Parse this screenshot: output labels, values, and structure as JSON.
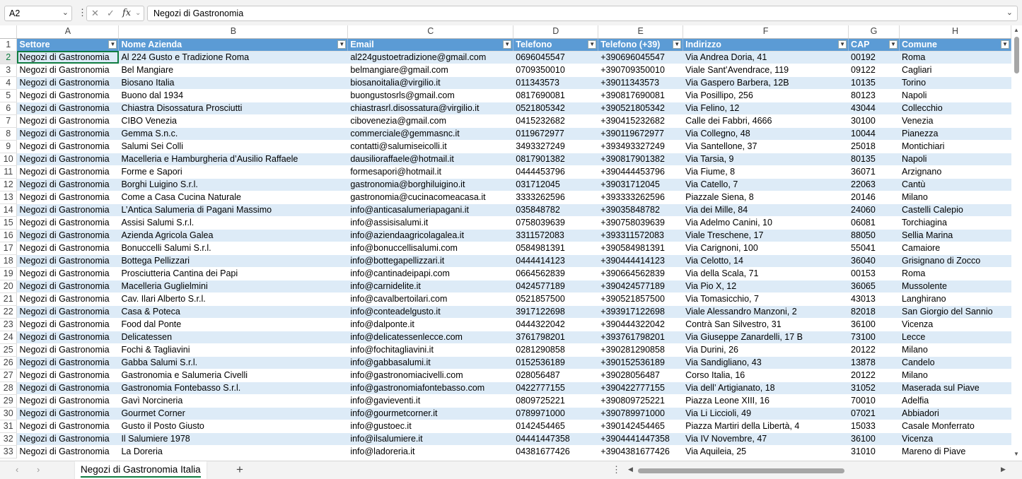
{
  "namebox": {
    "value": "A2"
  },
  "formula": {
    "value": "Negozi di Gastronomia",
    "fx_label": "fx"
  },
  "columns": [
    "A",
    "B",
    "C",
    "D",
    "E",
    "F",
    "G",
    "H"
  ],
  "headers": [
    "Settore",
    "Nome Azienda",
    "Email",
    "Telefono",
    "Telefono (+39)",
    "Indirizzo",
    "CAP",
    "Comune"
  ],
  "rows": [
    [
      "Negozi di Gastronomia",
      "Al 224 Gusto e Tradizione Roma",
      "al224gustoetradizione@gmail.com",
      "0696045547",
      "+390696045547",
      "Via Andrea Doria, 41",
      "00192",
      "Roma"
    ],
    [
      "Negozi di Gastronomia",
      "Bel Mangiare",
      "belmangiare@gmail.com",
      "0709350010",
      "+390709350010",
      "Viale Sant’Avendrace, 119",
      "09122",
      "Cagliari"
    ],
    [
      "Negozi di Gastronomia",
      "Biosano Italia",
      "biosanoitalia@virgilio.it",
      "011343573",
      "+39011343573",
      "Via Gaspero Barbera, 12B",
      "10135",
      "Torino"
    ],
    [
      "Negozi di Gastronomia",
      "Buono dal 1934",
      "buongustosrls@gmail.com",
      "0817690081",
      "+390817690081",
      "Via Posillipo, 256",
      "80123",
      "Napoli"
    ],
    [
      "Negozi di Gastronomia",
      "Chiastra Disossatura Prosciutti",
      "chiastrasrl.disossatura@virgilio.it",
      "0521805342",
      "+390521805342",
      "Via Felino, 12",
      "43044",
      "Collecchio"
    ],
    [
      "Negozi di Gastronomia",
      "CIBO Venezia",
      "cibovenezia@gmail.com",
      "0415232682",
      "+390415232682",
      "Calle dei Fabbri, 4666",
      "30100",
      "Venezia"
    ],
    [
      "Negozi di Gastronomia",
      "Gemma S.n.c.",
      "commerciale@gemmasnc.it",
      "0119672977",
      "+390119672977",
      "Via Collegno, 48",
      "10044",
      "Pianezza"
    ],
    [
      "Negozi di Gastronomia",
      "Salumi Sei Colli",
      "contatti@salumiseicolli.it",
      "3493327249",
      "+393493327249",
      "Via Santellone, 37",
      "25018",
      "Montichiari"
    ],
    [
      "Negozi di Gastronomia",
      "Macelleria e Hamburgheria d’Ausilio Raffaele",
      "dausilioraffaele@hotmail.it",
      "0817901382",
      "+390817901382",
      "Via Tarsia, 9",
      "80135",
      "Napoli"
    ],
    [
      "Negozi di Gastronomia",
      "Forme e Sapori",
      "formesapori@hotmail.it",
      "0444453796",
      "+390444453796",
      "Via Fiume, 8",
      "36071",
      "Arzignano"
    ],
    [
      "Negozi di Gastronomia",
      "Borghi Luigino S.r.l.",
      "gastronomia@borghiluigino.it",
      "031712045",
      "+39031712045",
      "Via Catello, 7",
      "22063",
      "Cantù"
    ],
    [
      "Negozi di Gastronomia",
      "Come a Casa Cucina Naturale",
      "gastronomia@cucinacomeacasa.it",
      "3333262596",
      "+393333262596",
      "Piazzale Siena, 8",
      "20146",
      "Milano"
    ],
    [
      "Negozi di Gastronomia",
      "L’Antica Salumeria di Pagani Massimo",
      "info@anticasalumeriapagani.it",
      "035848782",
      "+39035848782",
      "Via dei Mille, 84",
      "24060",
      "Castelli Calepio"
    ],
    [
      "Negozi di Gastronomia",
      "Assisi Salumi S.r.l.",
      "info@assisisalumi.it",
      "0758039639",
      "+390758039639",
      "Via Adelmo Canini, 10",
      "06081",
      "Torchiagina"
    ],
    [
      "Negozi di Gastronomia",
      "Azienda Agricola Galea",
      "info@aziendaagricolagalea.it",
      "3311572083",
      "+393311572083",
      "Viale Treschene, 17",
      "88050",
      "Sellia Marina"
    ],
    [
      "Negozi di Gastronomia",
      "Bonuccelli Salumi S.r.l.",
      "info@bonuccellisalumi.com",
      "0584981391",
      "+390584981391",
      "Via Carignoni, 100",
      "55041",
      "Camaiore"
    ],
    [
      "Negozi di Gastronomia",
      "Bottega Pellizzari",
      "info@bottegapellizzari.it",
      "0444414123",
      "+390444414123",
      "Via Celotto, 14",
      "36040",
      "Grisignano di Zocco"
    ],
    [
      "Negozi di Gastronomia",
      "Prosciutteria Cantina dei Papi",
      "info@cantinadeipapi.com",
      "0664562839",
      "+390664562839",
      "Via della Scala, 71",
      "00153",
      "Roma"
    ],
    [
      "Negozi di Gastronomia",
      "Macelleria Guglielmini",
      "info@carnidelite.it",
      "0424577189",
      "+390424577189",
      "Via Pio X, 12",
      "36065",
      "Mussolente"
    ],
    [
      "Negozi di Gastronomia",
      "Cav. Ilari Alberto S.r.l.",
      "info@cavalbertoilari.com",
      "0521857500",
      "+390521857500",
      "Via Tomasicchio, 7",
      "43013",
      "Langhirano"
    ],
    [
      "Negozi di Gastronomia",
      "Casa & Poteca",
      "info@conteadelgusto.it",
      "3917122698",
      "+393917122698",
      "Viale Alessandro Manzoni, 2",
      "82018",
      "San Giorgio del Sannio"
    ],
    [
      "Negozi di Gastronomia",
      "Food dal Ponte",
      "info@dalponte.it",
      "0444322042",
      "+390444322042",
      "Contrà San Silvestro, 31",
      "36100",
      "Vicenza"
    ],
    [
      "Negozi di Gastronomia",
      "Delicatessen",
      "info@delicatessenlecce.com",
      "3761798201",
      "+393761798201",
      "Via Giuseppe Zanardelli, 17 B",
      "73100",
      "Lecce"
    ],
    [
      "Negozi di Gastronomia",
      "Fochi & Tagliavini",
      "info@fochitagliavini.it",
      "0281290858",
      "+390281290858",
      "Via Durini, 26",
      "20122",
      "Milano"
    ],
    [
      "Negozi di Gastronomia",
      "Gabba Salumi S.r.l.",
      "info@gabbasalumi.it",
      "0152536189",
      "+390152536189",
      "Via Sandigliano, 43",
      "13878",
      "Candelo"
    ],
    [
      "Negozi di Gastronomia",
      "Gastronomia e Salumeria Civelli",
      "info@gastronomiacivelli.com",
      "028056487",
      "+39028056487",
      "Corso Italia, 16",
      "20122",
      "Milano"
    ],
    [
      "Negozi di Gastronomia",
      "Gastronomia Fontebasso S.r.l.",
      "info@gastronomiafontebasso.com",
      "0422777155",
      "+390422777155",
      "Via dell’ Artigianato, 18",
      "31052",
      "Maserada sul Piave"
    ],
    [
      "Negozi di Gastronomia",
      "Gavì Norcineria",
      "info@gavieventi.it",
      "0809725221",
      "+390809725221",
      "Piazza Leone XIII, 16",
      "70010",
      "Adelfia"
    ],
    [
      "Negozi di Gastronomia",
      "Gourmet Corner",
      "info@gourmetcorner.it",
      "0789971000",
      "+390789971000",
      "Via Li Liccioli, 49",
      "07021",
      "Abbiadori"
    ],
    [
      "Negozi di Gastronomia",
      "Gusto il Posto Giusto",
      "info@gustoec.it",
      "0142454465",
      "+390142454465",
      "Piazza Martiri della Libertà, 4",
      "15033",
      "Casale Monferrato"
    ],
    [
      "Negozi di Gastronomia",
      "Il Salumiere 1978",
      "info@ilsalumiere.it",
      "04441447358",
      "+3904441447358",
      "Via IV Novembre, 47",
      "36100",
      "Vicenza"
    ],
    [
      "Negozi di Gastronomia",
      "La Doreria",
      "info@ladoreria.it",
      "04381677426",
      "+3904381677426",
      "Via Aquileia, 25",
      "31010",
      "Mareno di Piave"
    ]
  ],
  "sheet_tab": {
    "label": "Negozi di Gastronomia Italia"
  },
  "add_sheet_label": "+"
}
